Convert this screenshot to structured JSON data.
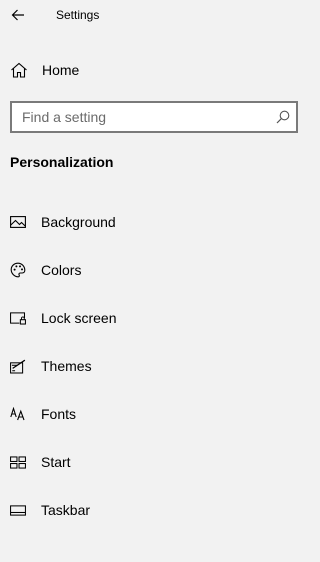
{
  "window": {
    "title": "Settings"
  },
  "home": {
    "label": "Home"
  },
  "search": {
    "placeholder": "Find a setting"
  },
  "section": {
    "title": "Personalization"
  },
  "nav": {
    "items": [
      {
        "label": "Background",
        "icon": "picture-icon"
      },
      {
        "label": "Colors",
        "icon": "palette-icon"
      },
      {
        "label": "Lock screen",
        "icon": "lock-screen-icon"
      },
      {
        "label": "Themes",
        "icon": "themes-icon"
      },
      {
        "label": "Fonts",
        "icon": "fonts-icon"
      },
      {
        "label": "Start",
        "icon": "start-icon"
      },
      {
        "label": "Taskbar",
        "icon": "taskbar-icon"
      }
    ]
  }
}
